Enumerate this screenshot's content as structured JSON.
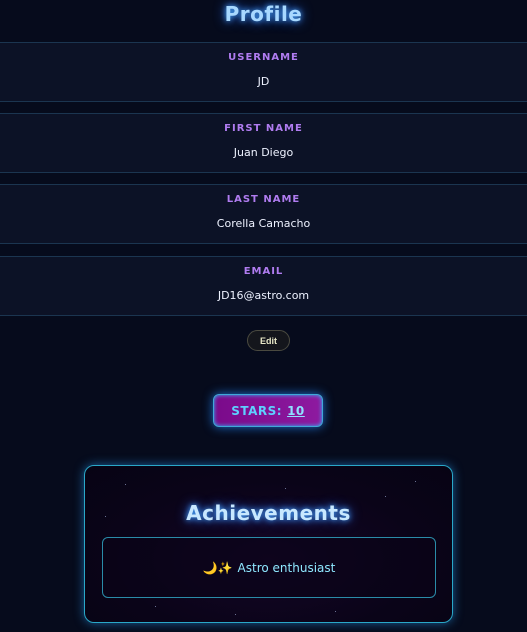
{
  "profile": {
    "title": "Profile",
    "fields": [
      {
        "label": "USERNAME",
        "value": "JD"
      },
      {
        "label": "FIRST NAME",
        "value": "Juan Diego"
      },
      {
        "label": "LAST NAME",
        "value": "Corella Camacho"
      },
      {
        "label": "EMAIL",
        "value": "JD16@astro.com"
      }
    ],
    "edit_label": "Edit"
  },
  "stars": {
    "label": "STARS:",
    "count": "10"
  },
  "achievements": {
    "title": "Achievements",
    "items": [
      {
        "icon": "🌙✨",
        "icon_name": "moon-sparkles-icon",
        "label": "Astro enthusiast"
      }
    ]
  },
  "colors": {
    "background": "#060b1c",
    "accent_cyan": "#5ed0ff",
    "accent_purple": "#b07cf0",
    "stars_badge": "#8e1aa0"
  }
}
